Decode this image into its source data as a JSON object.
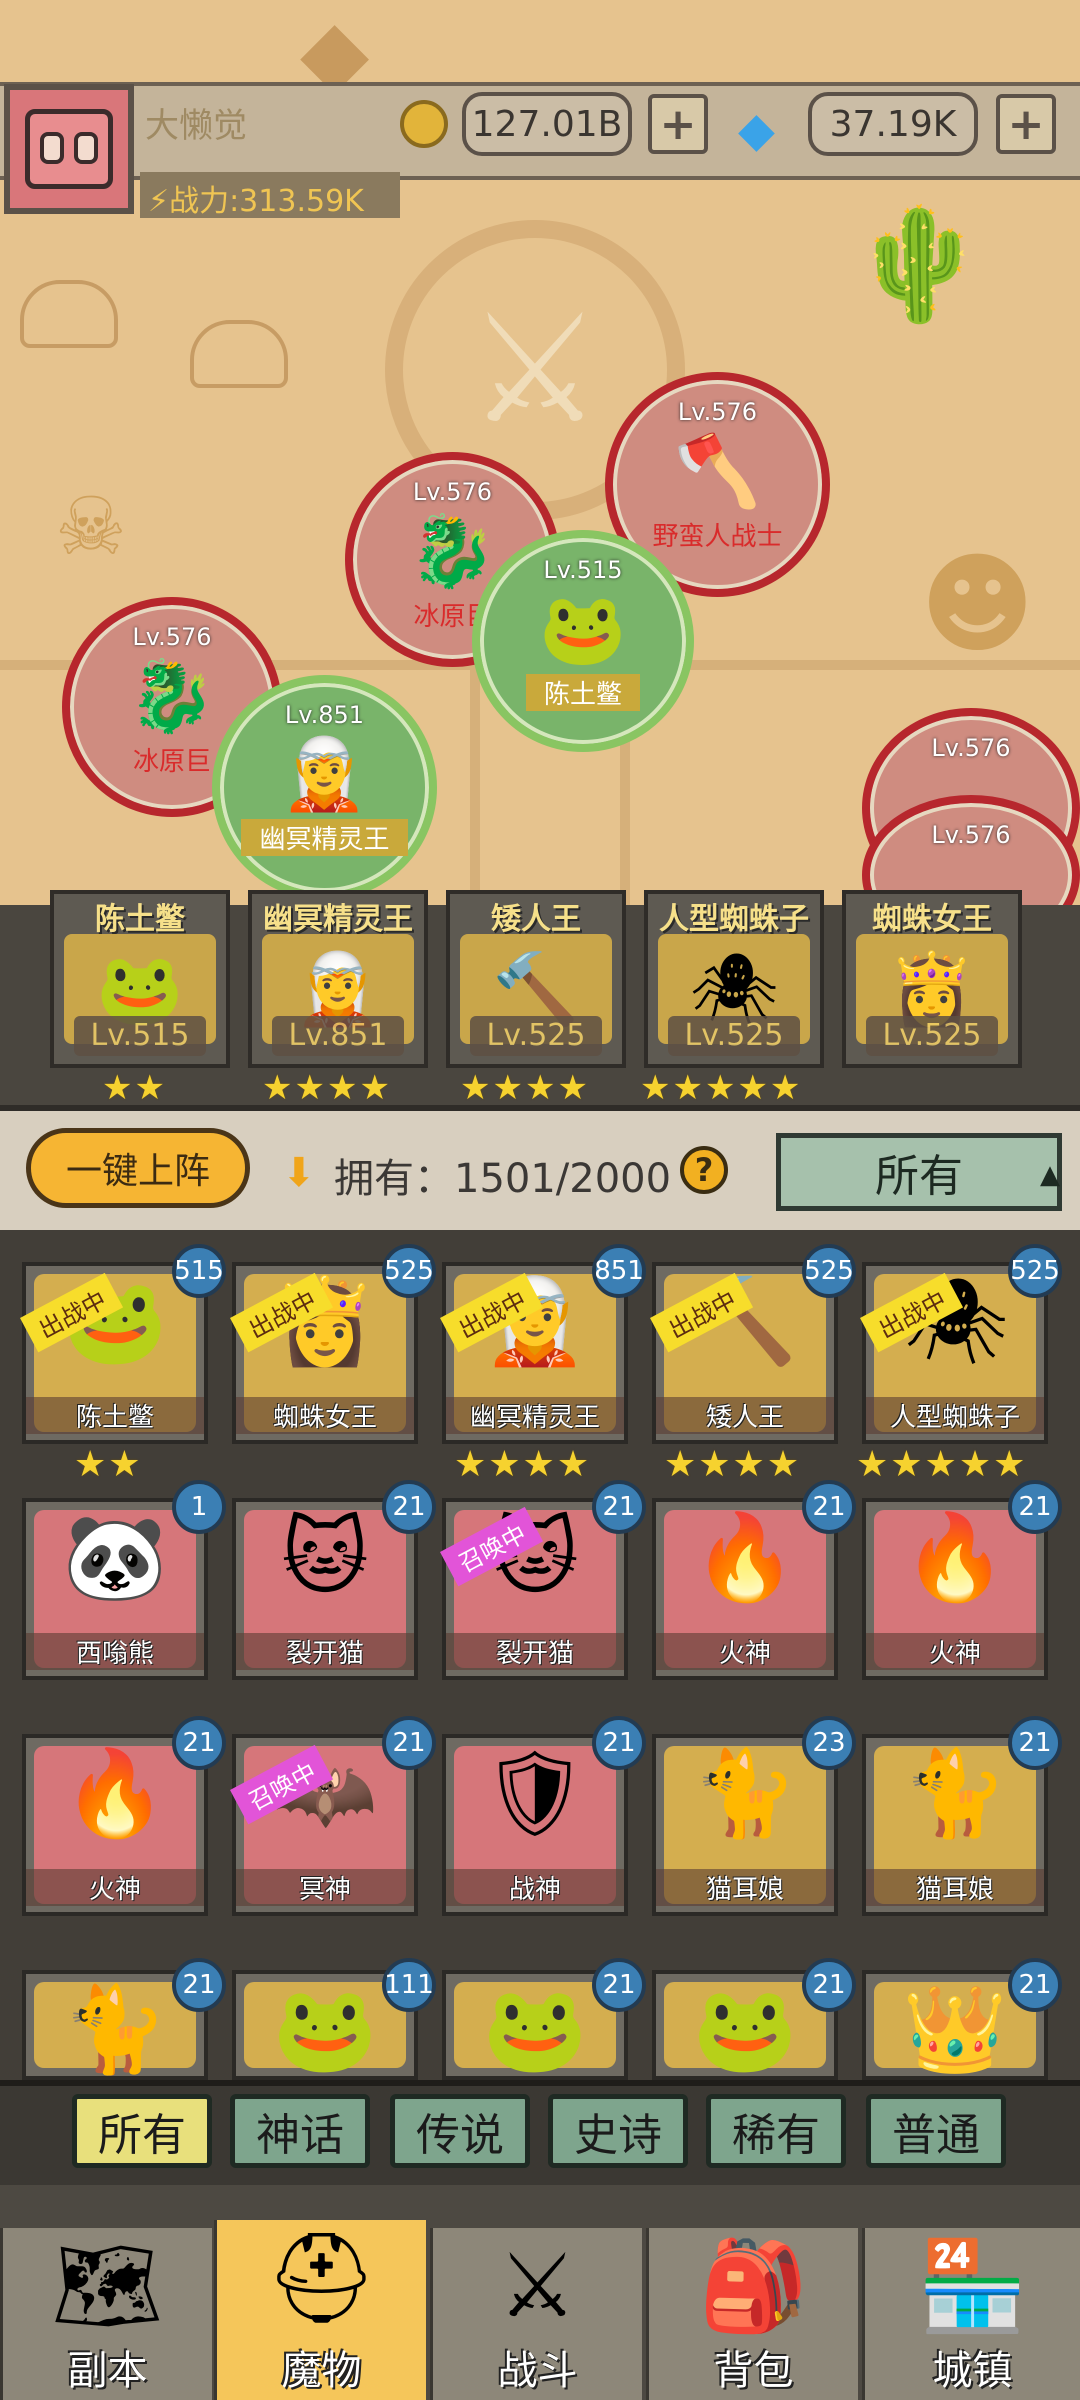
{
  "header": {
    "player_name": "大懒觉",
    "power_label": "战力:313.59K",
    "gold_amount": "127.01B",
    "gem_amount": "37.19K",
    "plus": "+"
  },
  "map_units": [
    {
      "lv": "Lv.576",
      "name": "野蛮人战士",
      "side": "enemy"
    },
    {
      "lv": "Lv.576",
      "name": "冰原巨",
      "side": "enemy"
    },
    {
      "lv": "Lv.515",
      "name": "陈土鳖",
      "side": "ally"
    },
    {
      "lv": "Lv.576",
      "name": "冰原巨",
      "side": "enemy"
    },
    {
      "lv": "Lv.851",
      "name": "幽冥精灵王",
      "side": "ally"
    },
    {
      "lv": "Lv.576",
      "name": "",
      "side": "enemy"
    },
    {
      "lv": "Lv.576",
      "name": "",
      "side": "enemy"
    }
  ],
  "lineup": [
    {
      "name": "陈土鳖",
      "lv": "Lv.515",
      "stars": "★★"
    },
    {
      "name": "幽冥精灵王",
      "lv": "Lv.851",
      "stars": "★★★★"
    },
    {
      "name": "矮人王",
      "lv": "Lv.525",
      "stars": "★★★★"
    },
    {
      "name": "人型蜘蛛子",
      "lv": "Lv.525",
      "stars": "★★★★★"
    },
    {
      "name": "蜘蛛女王",
      "lv": "Lv.525",
      "stars": ""
    }
  ],
  "controls": {
    "deploy_label": "一键上阵",
    "owned_label": "拥有：1501/2000",
    "help": "?",
    "filter_value": "所有",
    "caret": "▲"
  },
  "monsters": {
    "row1": [
      {
        "name": "陈土鳖",
        "level": "515",
        "tag": "出战中",
        "stars": "★★"
      },
      {
        "name": "蜘蛛女王",
        "level": "525",
        "tag": "出战中",
        "stars": ""
      },
      {
        "name": "幽冥精灵王",
        "level": "851",
        "tag": "出战中",
        "stars": "★★★★"
      },
      {
        "name": "矮人王",
        "level": "525",
        "tag": "出战中",
        "stars": "★★★★"
      },
      {
        "name": "人型蜘蛛子",
        "level": "525",
        "tag": "出战中",
        "stars": "★★★★★"
      }
    ],
    "row2": [
      {
        "name": "西嗡熊",
        "level": "1",
        "tag": ""
      },
      {
        "name": "裂开猫",
        "level": "21",
        "tag": ""
      },
      {
        "name": "裂开猫",
        "level": "21",
        "tag": "召唤中"
      },
      {
        "name": "火神",
        "level": "21",
        "tag": ""
      },
      {
        "name": "火神",
        "level": "21",
        "tag": ""
      }
    ],
    "row3": [
      {
        "name": "火神",
        "level": "21",
        "tag": ""
      },
      {
        "name": "冥神",
        "level": "21",
        "tag": "召唤中"
      },
      {
        "name": "战神",
        "level": "21",
        "tag": ""
      },
      {
        "name": "猫耳娘",
        "level": "23",
        "tag": ""
      },
      {
        "name": "猫耳娘",
        "level": "21",
        "tag": ""
      }
    ],
    "row4": [
      {
        "level": "21"
      },
      {
        "level": "111"
      },
      {
        "level": "21"
      },
      {
        "level": "21"
      },
      {
        "level": "21"
      }
    ]
  },
  "rarity_tabs": [
    "所有",
    "神话",
    "传说",
    "史诗",
    "稀有",
    "普通"
  ],
  "bottom_nav": [
    "副本",
    "魔物",
    "战斗",
    "背包",
    "城镇"
  ],
  "colors": {
    "accent_gold": "#f6b533",
    "enemy_ring": "#b7272d",
    "ally_ring": "#89c562",
    "level_badge": "#3b7fb4"
  },
  "icons": {
    "gold": "coin-icon",
    "gem": "diamond-icon",
    "power": "power-icon"
  }
}
